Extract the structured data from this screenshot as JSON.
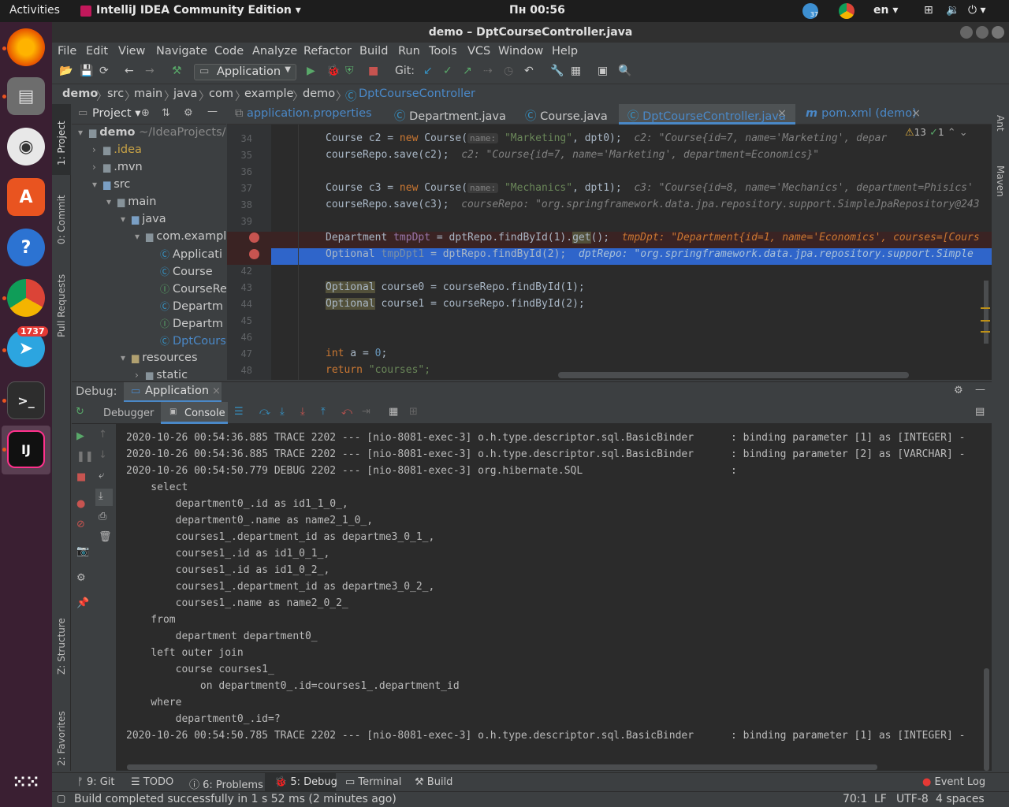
{
  "topbar": {
    "activities": "Activities",
    "app": "IntelliJ IDEA Community Edition ▾",
    "clock": "Пн 00:56",
    "lang": "en ▾",
    "notif_badge": "37"
  },
  "dock": {
    "telegram_badge": "1737"
  },
  "window": {
    "title": "demo – DptCourseController.java"
  },
  "menu": [
    "File",
    "Edit",
    "View",
    "Navigate",
    "Code",
    "Analyze",
    "Refactor",
    "Build",
    "Run",
    "Tools",
    "VCS",
    "Window",
    "Help"
  ],
  "toolbar": {
    "run_config": "Application",
    "git_label": "Git:"
  },
  "breadcrumb": [
    "demo",
    "src",
    "main",
    "java",
    "com",
    "example",
    "demo",
    "DptCourseController"
  ],
  "project": {
    "title": "Project ▾",
    "tree": [
      {
        "label": "demo",
        "extra": " ~/IdeaProjects/",
        "indent": 0
      },
      {
        "label": ".idea",
        "indent": 1
      },
      {
        "label": ".mvn",
        "indent": 1
      },
      {
        "label": "src",
        "indent": 1
      },
      {
        "label": "main",
        "indent": 2
      },
      {
        "label": "java",
        "indent": 3
      },
      {
        "label": "com.exampl",
        "indent": 4
      },
      {
        "label": "Applicati",
        "indent": 5
      },
      {
        "label": "Course",
        "indent": 5
      },
      {
        "label": "CourseRe",
        "indent": 5
      },
      {
        "label": "Departm",
        "indent": 5
      },
      {
        "label": "Departm",
        "indent": 5
      },
      {
        "label": "DptCours",
        "indent": 5
      },
      {
        "label": "resources",
        "indent": 3
      },
      {
        "label": "static",
        "indent": 4
      }
    ]
  },
  "side_tabs": {
    "project": "1: Project",
    "commit": "0: Commit",
    "pull": "Pull Requests",
    "structure": "Z: Structure",
    "favorites": "2: Favorites",
    "ant": "Ant",
    "maven": "Maven"
  },
  "tabs": [
    "application.properties",
    "Department.java",
    "Course.java",
    "DptCourseController.java",
    "pom.xml (demo)"
  ],
  "inspections": {
    "warnings": "13",
    "ok": "1"
  },
  "line_numbers": [
    "34",
    "35",
    "36",
    "37",
    "38",
    "39",
    "40",
    "41",
    "42",
    "43",
    "44",
    "45",
    "46",
    "47",
    "48"
  ],
  "code": {
    "l34_a": "Course c2 = ",
    "l34_new": "new",
    "l34_b": " Course(",
    "l34_hint": "name:",
    "l34_str": "\"Marketing\"",
    "l34_c": ", dpt0);  ",
    "l34_cm": "c2: \"Course{id=7, name='Marketing', depar",
    "l35_a": "courseRepo.save(c2);  ",
    "l35_cm": "c2: \"Course{id=7, name='Marketing', department=Economics}\"",
    "l37_a": "Course c3 = ",
    "l37_new": "new",
    "l37_b": " Course(",
    "l37_hint": "name:",
    "l37_str": "\"Mechanics\"",
    "l37_c": ", dpt1);  ",
    "l37_cm": "c3: \"Course{id=8, name='Mechanics', department=Phisics'",
    "l38_a": "courseRepo.save(c3);  ",
    "l38_cm": "courseRepo: \"org.springframework.data.jpa.repository.support.SimpleJpaRepository@243",
    "l40_a": "Department ",
    "l40_v": "tmpDpt",
    "l40_b": " = dptRepo.findById(1).",
    "l40_get": "get",
    "l40_c": "();  ",
    "l40_cm": "tmpDpt: \"Department{id=1, name='Economics', courses=[Cours",
    "l41_a": "Optional ",
    "l41_v": "tmpDpt1",
    "l41_b": " = dptRepo.findById(2);  ",
    "l41_cm": "dptRepo: \"org.springframework.data.jpa.repository.support.Simple",
    "l43_a": "Optional",
    "l43_b": " course0 = courseRepo.findById(1);",
    "l44_a": "Optional",
    "l44_b": " course1 = courseRepo.findById(2);",
    "l47_int": "int",
    "l47_b": " a = ",
    "l47_num": "0",
    "l47_c": ";",
    "l48_ret": "return",
    "l48_str": " \"courses\";"
  },
  "debug": {
    "label": "Debug:",
    "session": "Application",
    "tab_debugger": "Debugger",
    "tab_console": "Console"
  },
  "console": [
    "2020-10-26 00:54:36.885 TRACE 2202 --- [nio-8081-exec-3] o.h.type.descriptor.sql.BasicBinder      : binding parameter [1] as [INTEGER] -",
    "2020-10-26 00:54:36.885 TRACE 2202 --- [nio-8081-exec-3] o.h.type.descriptor.sql.BasicBinder      : binding parameter [2] as [VARCHAR] -",
    "2020-10-26 00:54:50.779 DEBUG 2202 --- [nio-8081-exec-3] org.hibernate.SQL                        :",
    "    select",
    "        department0_.id as id1_1_0_,",
    "        department0_.name as name2_1_0_,",
    "        courses1_.department_id as departme3_0_1_,",
    "        courses1_.id as id1_0_1_,",
    "        courses1_.id as id1_0_2_,",
    "        courses1_.department_id as departme3_0_2_,",
    "        courses1_.name as name2_0_2_",
    "    from",
    "        department department0_",
    "    left outer join",
    "        course courses1_",
    "            on department0_.id=courses1_.department_id",
    "    where",
    "        department0_.id=?",
    "2020-10-26 00:54:50.785 TRACE 2202 --- [nio-8081-exec-3] o.h.type.descriptor.sql.BasicBinder      : binding parameter [1] as [INTEGER] -"
  ],
  "bottom_tabs": {
    "git": "9: Git",
    "todo": "TODO",
    "problems": "6: Problems",
    "debug": "5: Debug",
    "terminal": "Terminal",
    "build": "Build",
    "eventlog": "Event Log"
  },
  "status": {
    "message": "Build completed successfully in 1 s 52 ms (2 minutes ago)",
    "pos": "70:1",
    "lf": "LF",
    "enc": "UTF-8",
    "indent": "4 spaces"
  },
  "colors": {
    "accent": "#4a88c7",
    "selection": "#2f65ca",
    "keyword": "#cc7832",
    "string": "#6a8759",
    "breakpoint": "#c75450"
  }
}
